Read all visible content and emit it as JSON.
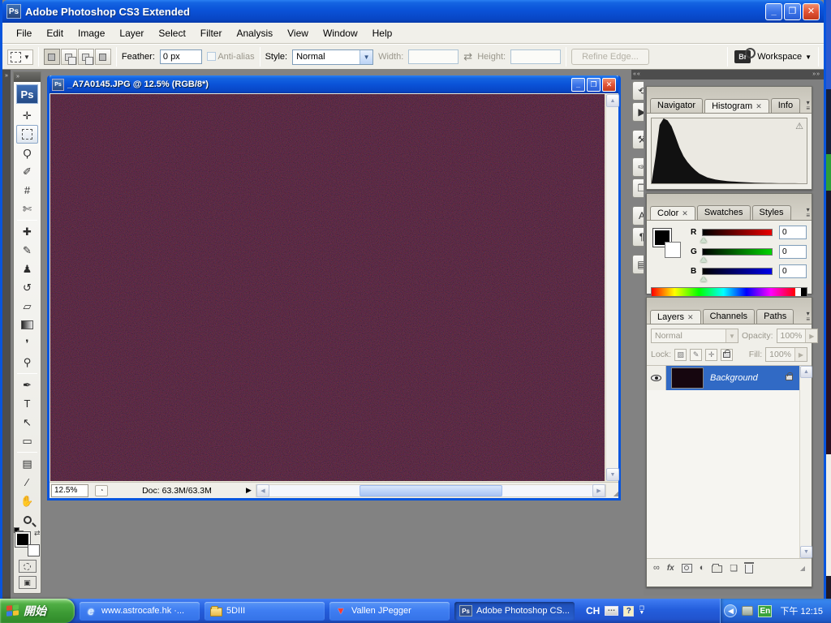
{
  "window": {
    "title": "Adobe Photoshop CS3 Extended",
    "app_badge": "Ps"
  },
  "menu": {
    "items": [
      "File",
      "Edit",
      "Image",
      "Layer",
      "Select",
      "Filter",
      "Analysis",
      "View",
      "Window",
      "Help"
    ]
  },
  "options_bar": {
    "feather_label": "Feather:",
    "feather_value": "0 px",
    "anti_alias_label": "Anti-alias",
    "style_label": "Style:",
    "style_value": "Normal",
    "width_label": "Width:",
    "width_value": "",
    "height_label": "Height:",
    "height_value": "",
    "refine_edge_label": "Refine Edge...",
    "bridge_badge": "Br",
    "workspace_label": "Workspace"
  },
  "toolbox": {
    "logo": "Ps",
    "foreground_color": "#000000",
    "background_color": "#ffffff",
    "tools": [
      {
        "name": "move-tool",
        "glyph": "✛"
      },
      {
        "name": "rectangular-marquee-tool",
        "glyph": "",
        "style": "marquee",
        "selected": true
      },
      {
        "name": "lasso-tool",
        "glyph": "Ϙ"
      },
      {
        "name": "quick-selection-tool",
        "glyph": "✐"
      },
      {
        "name": "crop-tool",
        "glyph": "#"
      },
      {
        "name": "slice-tool",
        "glyph": "✄"
      },
      {
        "name": "spot-healing-brush-tool",
        "glyph": "✚",
        "sep": true
      },
      {
        "name": "brush-tool",
        "glyph": "✎"
      },
      {
        "name": "clone-stamp-tool",
        "glyph": "♟"
      },
      {
        "name": "history-brush-tool",
        "glyph": "↺"
      },
      {
        "name": "eraser-tool",
        "glyph": "▱"
      },
      {
        "name": "gradient-tool",
        "glyph": "",
        "style": "gradient"
      },
      {
        "name": "blur-tool",
        "glyph": "❜"
      },
      {
        "name": "dodge-tool",
        "glyph": "⚲"
      },
      {
        "name": "pen-tool",
        "glyph": "✒",
        "sep": true
      },
      {
        "name": "horizontal-type-tool",
        "glyph": "T"
      },
      {
        "name": "path-selection-tool",
        "glyph": "↖"
      },
      {
        "name": "rectangle-tool",
        "glyph": "▭"
      },
      {
        "name": "notes-tool",
        "glyph": "▤",
        "sep": true
      },
      {
        "name": "eyedropper-tool",
        "glyph": "∕"
      },
      {
        "name": "hand-tool",
        "glyph": "✋"
      },
      {
        "name": "zoom-tool",
        "glyph": "",
        "style": "zoom"
      }
    ]
  },
  "document": {
    "title": "_A7A0145.JPG @ 12.5% (RGB/8*)",
    "zoom_field": "12.5%",
    "doc_size": "Doc: 63.3M/63.3M"
  },
  "icon_dock": {
    "items": [
      {
        "name": "history-panel-icon",
        "glyph": "⟲"
      },
      {
        "name": "actions-panel-icon",
        "glyph": "▶"
      },
      {
        "name": "tool-presets-panel-icon",
        "glyph": "⚒",
        "gap": true
      },
      {
        "name": "brushes-panel-icon",
        "glyph": "✑",
        "gap": true
      },
      {
        "name": "clone-source-panel-icon",
        "glyph": "❐"
      },
      {
        "name": "character-panel-icon",
        "glyph": "A",
        "gap": true
      },
      {
        "name": "paragraph-panel-icon",
        "glyph": "¶"
      },
      {
        "name": "layer-comps-panel-icon",
        "glyph": "▤",
        "gap": true
      }
    ]
  },
  "panels": {
    "navigator_group": {
      "tabs": [
        {
          "label": "Navigator",
          "active": false
        },
        {
          "label": "Histogram",
          "active": true
        },
        {
          "label": "Info",
          "active": false
        }
      ]
    },
    "histogram": {
      "points": [
        0.02,
        0.42,
        0.9,
        1.0,
        0.97,
        0.88,
        0.72,
        0.55,
        0.42,
        0.33,
        0.26,
        0.2,
        0.15,
        0.12,
        0.09,
        0.075,
        0.06,
        0.05,
        0.042,
        0.035,
        0.03,
        0.026,
        0.022,
        0.018,
        0.015,
        0.012,
        0.01,
        0.008,
        0.006,
        0.005,
        0.004,
        0.003,
        0.002,
        0.002,
        0.001,
        0.001,
        0.001,
        0.0,
        0.0,
        0.0
      ]
    },
    "color_group": {
      "tabs": [
        {
          "label": "Color",
          "active": true
        },
        {
          "label": "Swatches",
          "active": false
        },
        {
          "label": "Styles",
          "active": false
        }
      ],
      "channels": [
        {
          "label": "R",
          "value": "0",
          "hex": "#e80000"
        },
        {
          "label": "G",
          "value": "0",
          "hex": "#00d400"
        },
        {
          "label": "B",
          "value": "0",
          "hex": "#0000e8"
        }
      ]
    },
    "layers_group": {
      "tabs": [
        {
          "label": "Layers",
          "active": true
        },
        {
          "label": "Channels",
          "active": false
        },
        {
          "label": "Paths",
          "active": false
        }
      ],
      "blend_mode": "Normal",
      "opacity_label": "Opacity:",
      "opacity_value": "100%",
      "lock_label": "Lock:",
      "fill_label": "Fill:",
      "fill_value": "100%",
      "layers": [
        {
          "name": "Background",
          "visible": true,
          "locked": true,
          "selected": true
        }
      ],
      "bottom_buttons": [
        {
          "name": "link-layers-button",
          "glyph": "∞"
        },
        {
          "name": "layer-style-button",
          "glyph": "fx",
          "style": "fx"
        },
        {
          "name": "add-layer-mask-button",
          "style": "mask"
        },
        {
          "name": "adjustment-layer-button",
          "glyph": "◐"
        },
        {
          "name": "new-group-button",
          "style": "folder"
        },
        {
          "name": "new-layer-button",
          "glyph": "❏"
        },
        {
          "name": "delete-layer-button",
          "style": "trash"
        }
      ]
    }
  },
  "taskbar": {
    "start_label": "開始",
    "buttons": [
      {
        "name": "taskbar-button-astrocafe",
        "label": "www.astrocafe.hk ·...",
        "icon": "ie",
        "active": false
      },
      {
        "name": "taskbar-button-5diii",
        "label": "5DIII",
        "icon": "folder",
        "active": false
      },
      {
        "name": "taskbar-button-vallen-jpegger",
        "label": "Vallen JPegger",
        "icon": "vallen",
        "active": false
      },
      {
        "name": "taskbar-button-photoshop",
        "label": "Adobe Photoshop CS...",
        "icon": "ps",
        "active": true
      }
    ],
    "language_indicator": "CH",
    "tray_language": "En",
    "clock": "下午 12:15"
  }
}
